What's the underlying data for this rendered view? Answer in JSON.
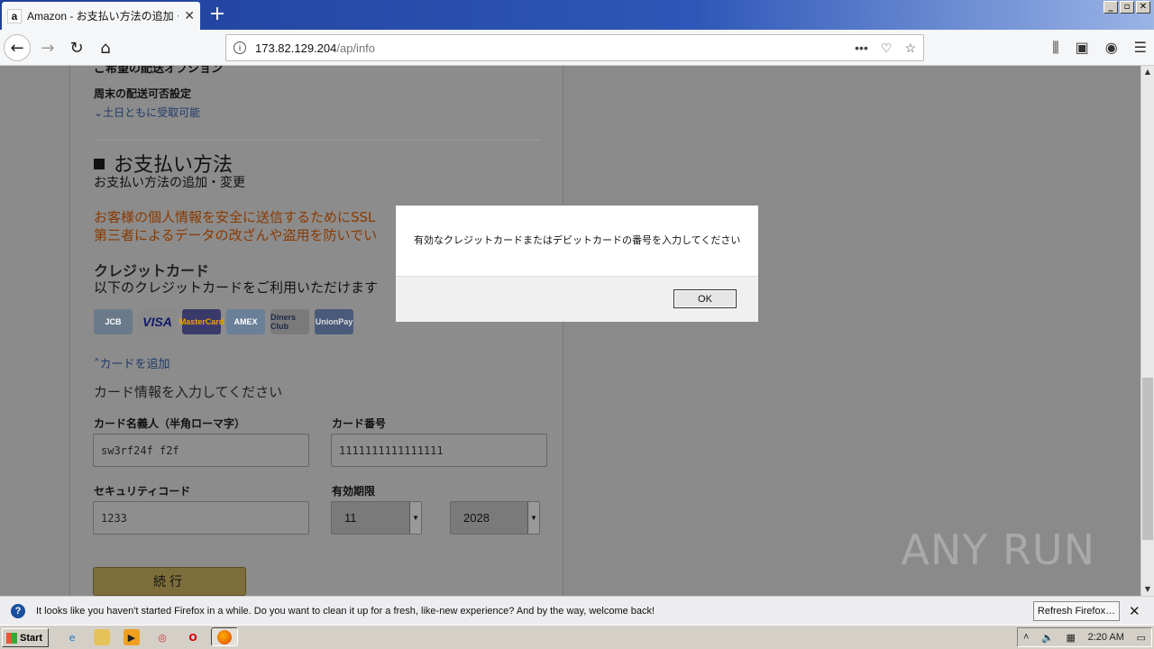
{
  "browser": {
    "tab_title": "Amazon - お支払い方法の追加・変",
    "favicon_letter": "a",
    "url_host": "173.82.129.204",
    "url_path": "/ap/info",
    "window_buttons": [
      "_",
      "▫",
      "✕"
    ]
  },
  "page": {
    "section_cut_title": "ご希望の配送オプション",
    "weekend_title": "周末の配送可否設定",
    "weekend_value": "土日ともに受取可能",
    "payment_heading": "お支払い方法",
    "payment_sub": "お支払い方法の追加・変更",
    "ssl_line1": "お客様の個人情報を安全に送信するためにSSL",
    "ssl_line2": "第三者によるデータの改ざんや盗用を防いでい",
    "credit_heading": "クレジットカード",
    "credit_sub": "以下のクレジットカードをご利用いただけます",
    "cards": [
      "JCB",
      "VISA",
      "MasterCard",
      "AMEX",
      "Diners Club",
      "UnionPay"
    ],
    "add_card": "カードを追加",
    "enter_info": "カード情報を入力してください",
    "name_label": "カード名義人（半角ローマ字）",
    "name_value": "sw3rf24f f2f",
    "number_label": "カード番号",
    "number_value": "1111111111111111",
    "security_label": "セキュリティコード",
    "security_value": "1233",
    "expiry_label": "有効期限",
    "expiry_month": "11",
    "expiry_year": "2028",
    "continue_label": "続行"
  },
  "dialog": {
    "message": "有効なクレジットカードまたはデビットカードの番号を入力してください",
    "ok_label": "OK"
  },
  "notification": {
    "text": "It looks like you haven't started Firefox in a while. Do you want to clean it up for a fresh, like-new experience? And by the way, welcome back!",
    "refresh_label": "Refresh Firefox…"
  },
  "taskbar": {
    "start_label": "Start",
    "clock": "2:20 AM"
  },
  "watermark": "ANY RUN"
}
